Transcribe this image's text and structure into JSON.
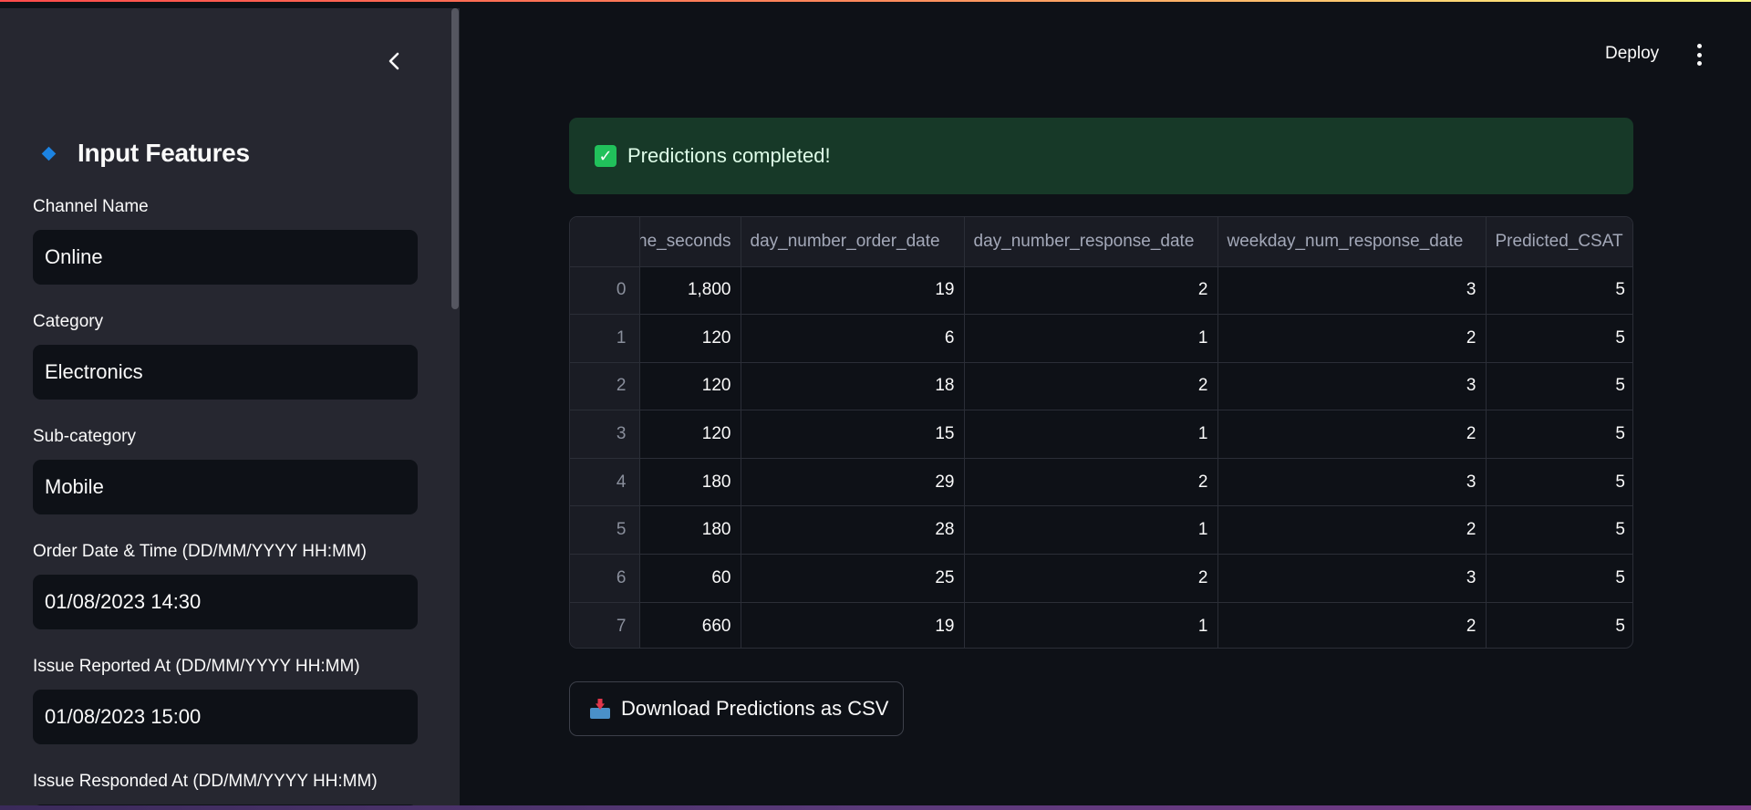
{
  "sidebar": {
    "title": "Input Features",
    "fields": [
      {
        "label": "Channel Name",
        "value": "Online"
      },
      {
        "label": "Category",
        "value": "Electronics"
      },
      {
        "label": "Sub-category",
        "value": "Mobile"
      },
      {
        "label": "Order Date & Time (DD/MM/YYYY HH:MM)",
        "value": "01/08/2023 14:30"
      },
      {
        "label": "Issue Reported At (DD/MM/YYYY HH:MM)",
        "value": "01/08/2023 15:00"
      },
      {
        "label": "Issue Responded At (DD/MM/YYYY HH:MM)",
        "value": ""
      }
    ]
  },
  "header": {
    "deploy_label": "Deploy"
  },
  "alert": {
    "text": "Predictions completed!"
  },
  "table": {
    "columns": [
      "he_seconds",
      "day_number_order_date",
      "day_number_response_date",
      "weekday_num_response_date",
      "Predicted_CSAT"
    ],
    "rows": [
      {
        "index": "0",
        "cells": [
          "1,800",
          "19",
          "2",
          "3",
          "5"
        ]
      },
      {
        "index": "1",
        "cells": [
          "120",
          "6",
          "1",
          "2",
          "5"
        ]
      },
      {
        "index": "2",
        "cells": [
          "120",
          "18",
          "2",
          "3",
          "5"
        ]
      },
      {
        "index": "3",
        "cells": [
          "120",
          "15",
          "1",
          "2",
          "5"
        ]
      },
      {
        "index": "4",
        "cells": [
          "180",
          "29",
          "2",
          "3",
          "5"
        ]
      },
      {
        "index": "5",
        "cells": [
          "180",
          "28",
          "1",
          "2",
          "5"
        ]
      },
      {
        "index": "6",
        "cells": [
          "60",
          "25",
          "2",
          "3",
          "5"
        ]
      },
      {
        "index": "7",
        "cells": [
          "660",
          "19",
          "1",
          "2",
          "5"
        ]
      }
    ]
  },
  "download": {
    "label": "Download Predictions as CSV"
  },
  "colors": {
    "accent_blue": "#1c83e1",
    "success_bg": "#173928",
    "success_check": "#21c15b",
    "app_bg": "#0e1117",
    "sidebar_bg": "#262730"
  }
}
